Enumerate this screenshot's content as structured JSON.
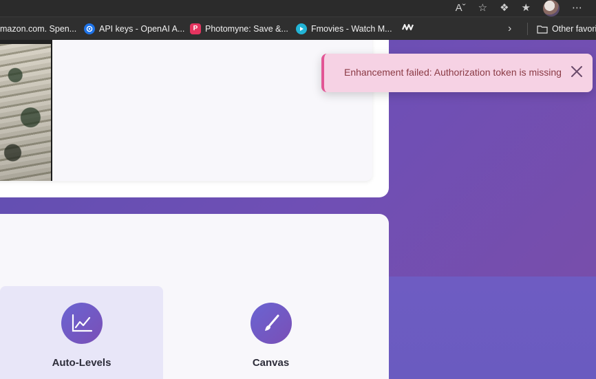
{
  "browser": {
    "bookmarks": [
      {
        "label": "mazon.com. Spen...",
        "icon": "amazon-icon"
      },
      {
        "label": "API keys - OpenAI A...",
        "icon": "openai-icon"
      },
      {
        "label": "Photomyne: Save &...",
        "icon": "photomyne-icon",
        "glyph": "P"
      },
      {
        "label": "Fmovies - Watch M...",
        "icon": "play-icon"
      },
      {
        "label": "",
        "icon": "wave-icon"
      }
    ],
    "other_favorites": "Other favori",
    "toolbar_icons": [
      "read-aloud-icon",
      "favorite-star-icon",
      "extensions-icon",
      "favorites-icon",
      "profile-avatar",
      "more-icon"
    ]
  },
  "toast": {
    "message": "Enhancement failed: Authorization token is missing",
    "accent": "#e25595",
    "background": "#f6d2e4"
  },
  "tools": [
    {
      "label": "Auto-Levels",
      "icon": "chart-line-icon",
      "active": true
    },
    {
      "label": "Canvas",
      "icon": "brush-icon",
      "active": false
    }
  ],
  "colors": {
    "page_gradient_start": "#5e4fb0",
    "page_gradient_end": "#7a4ea8",
    "tool_icon_gradient_start": "#6a64d2",
    "tool_icon_gradient_end": "#7a4fb6"
  }
}
